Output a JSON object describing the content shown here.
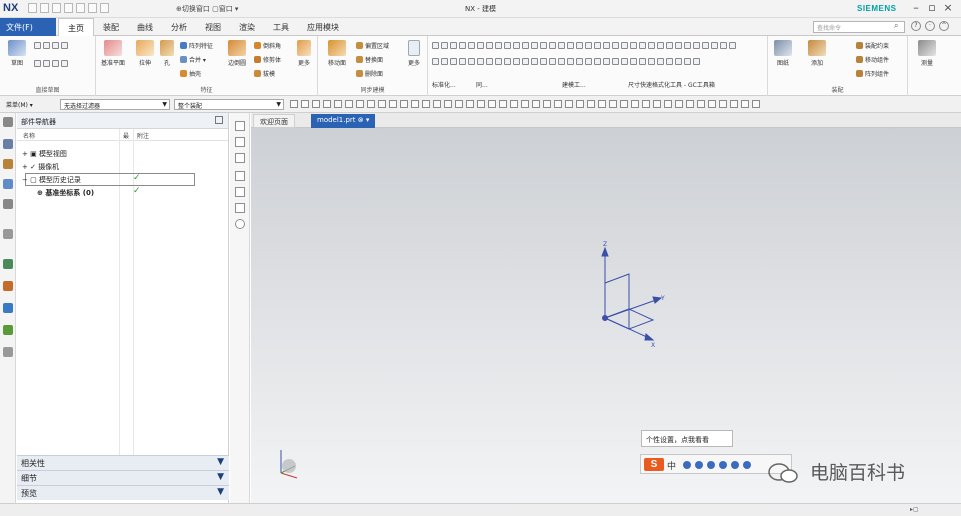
{
  "app": {
    "logo": "NX",
    "window_title": "NX - 建模",
    "brand": "SIEMENS",
    "quick_access_text": "⊕切换窗口 ▢窗口 ▾"
  },
  "menu": {
    "file_label": "文件(F)",
    "tabs": [
      "主页",
      "装配",
      "曲线",
      "分析",
      "视图",
      "渲染",
      "工具",
      "应用模块"
    ],
    "active_tab": "主页",
    "search_placeholder": "查找命令"
  },
  "ribbon": {
    "groups": {
      "sketch": "直接草图",
      "feature": "特征",
      "sync": "同步建模",
      "standard": "标准化...",
      "assembly": "装配"
    },
    "buttons": {
      "sketch": "草图",
      "datum_plane": "基准平面",
      "extrude": "拉伸",
      "hole": "孔",
      "shell": "边倒圆",
      "more1": "更多",
      "move_face": "移动面",
      "more2": "更多",
      "drawing": "图纸",
      "add": "添加",
      "measure": "测量"
    },
    "small_items": {
      "pattern_feature": "阵列特征",
      "unite": "合并 ▾",
      "trim": "抽壳",
      "chamfer": "倒斜角",
      "trim_body": "修剪体",
      "draft": "拔模",
      "offset_region": "偏置区域",
      "replace_face": "替换面",
      "delete_face": "删除面",
      "assy_constraint": "装配约束",
      "move_component": "移动组件",
      "pattern_component": "阵列组件"
    },
    "toolbar_labels": {
      "sync_more": "同...",
      "dim": "尺寸快速格式化工具 - GC工具箱",
      "modeling": "建模工..."
    }
  },
  "selection_bar": {
    "menu_label": "菜单(M) ▾",
    "filter": "无选择过滤器",
    "scope": "整个装配"
  },
  "navigator": {
    "title": "部件导航器",
    "columns": {
      "name": "名称",
      "latest": "最",
      "note": "附注"
    },
    "rows": [
      {
        "label": "模型视图"
      },
      {
        "label": "摄像机"
      },
      {
        "label": "模型历史记录"
      },
      {
        "label": "基准坐标系 (0)"
      }
    ],
    "panels": [
      "相关性",
      "细节",
      "预览"
    ]
  },
  "tabs": {
    "welcome": "欢迎页面",
    "model": "model1.prt"
  },
  "axes": {
    "x": "X",
    "y": "Y",
    "z": "Z"
  },
  "tooltip": "个性设置，点我看看",
  "ime": {
    "logo": "S",
    "mode": "中"
  },
  "watermark": "电脑百科书",
  "status": "▸▢"
}
